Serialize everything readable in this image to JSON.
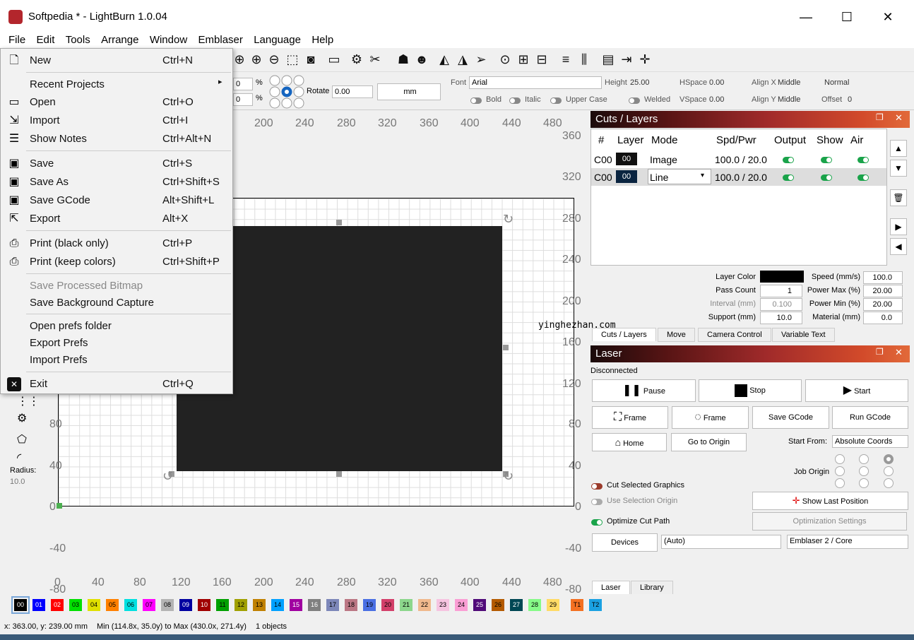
{
  "window": {
    "title": "Softpedia * - LightBurn 1.0.04",
    "minimize": "—",
    "maximize": "☐",
    "close": "✕"
  },
  "menubar": [
    "File",
    "Edit",
    "Tools",
    "Arrange",
    "Window",
    "Emblaser",
    "Language",
    "Help"
  ],
  "file_menu": [
    {
      "label": "New",
      "shortcut": "Ctrl+N",
      "icon": "new-file-icon"
    },
    {
      "label": "Recent Projects",
      "shortcut": "▸"
    },
    {
      "label": "Open",
      "shortcut": "Ctrl+O",
      "icon": "folder-icon"
    },
    {
      "label": "Import",
      "shortcut": "Ctrl+I",
      "icon": "import-icon"
    },
    {
      "label": "Show Notes",
      "shortcut": "Ctrl+Alt+N",
      "icon": "notes-icon"
    },
    {
      "label": "Save",
      "shortcut": "Ctrl+S",
      "icon": "save-icon"
    },
    {
      "label": "Save As",
      "shortcut": "Ctrl+Shift+S",
      "icon": "save-as-icon"
    },
    {
      "label": "Save GCode",
      "shortcut": "Alt+Shift+L",
      "icon": "save-gcode-icon"
    },
    {
      "label": "Export",
      "shortcut": "Alt+X",
      "icon": "export-icon"
    },
    {
      "label": "Print (black only)",
      "shortcut": "Ctrl+P",
      "icon": "printer-icon"
    },
    {
      "label": "Print (keep colors)",
      "shortcut": "Ctrl+Shift+P",
      "icon": "printer-color-icon"
    },
    {
      "label": "Save Processed Bitmap",
      "shortcut": ""
    },
    {
      "label": "Save Background Capture",
      "shortcut": ""
    },
    {
      "label": "Open prefs folder",
      "shortcut": ""
    },
    {
      "label": "Export Prefs",
      "shortcut": ""
    },
    {
      "label": "Import Prefs",
      "shortcut": ""
    },
    {
      "label": "Exit",
      "shortcut": "Ctrl+Q",
      "icon": "exit-icon"
    }
  ],
  "toolbar2": {
    "pct1": "0",
    "pct2": "0",
    "pct": "%",
    "rotate_label": "Rotate",
    "rotate": "0.00",
    "units": "mm",
    "font_label": "Font",
    "font": "Arial",
    "height_label": "Height",
    "height": "25.00",
    "hspace_label": "HSpace",
    "hspace": "0.00",
    "alignx_label": "Align X",
    "alignx": "Middle",
    "normal": "Normal",
    "bold": "Bold",
    "italic": "Italic",
    "upper": "Upper Case",
    "welded": "Welded",
    "vspace_label": "VSpace",
    "vspace": "0.00",
    "aligny_label": "Align Y",
    "aligny": "Middle",
    "offset_label": "Offset",
    "offset": "0"
  },
  "axis": {
    "top": [
      "200",
      "240",
      "280",
      "320",
      "360",
      "400",
      "440",
      "480"
    ],
    "bottom": [
      "0",
      "40",
      "80",
      "120",
      "160",
      "200",
      "240",
      "280",
      "320",
      "360",
      "400",
      "440",
      "480"
    ],
    "left": [
      "80",
      "40",
      "0",
      "-40",
      "-80"
    ],
    "right": [
      "360",
      "320",
      "280",
      "240",
      "200",
      "160",
      "120",
      "80",
      "40",
      "0",
      "-40",
      "-80"
    ]
  },
  "lefttools": {
    "radius_label": "Radius:",
    "radius": "10.0"
  },
  "cuts": {
    "title": "Cuts / Layers",
    "headers": [
      "#",
      "Layer",
      "Mode",
      "Spd/Pwr",
      "Output",
      "Show",
      "Air"
    ],
    "rows": [
      {
        "num": "C00",
        "layer": "00",
        "mode": "Image",
        "spd": "100.0 / 20.0"
      },
      {
        "num": "C00",
        "layer": "00",
        "mode": "Line",
        "spd": "100.0 / 20.0"
      }
    ],
    "props": {
      "layer_color": "Layer Color",
      "speed": "Speed (mm/s)",
      "speed_val": "100.0",
      "pass": "Pass Count",
      "pass_val": "1",
      "pmax": "Power Max (%)",
      "pmax_val": "20.00",
      "interval": "Interval (mm)",
      "interval_val": "0.100",
      "pmin": "Power Min (%)",
      "pmin_val": "20.00",
      "support": "Support (mm)",
      "support_val": "10.0",
      "material": "Material (mm)",
      "material_val": "0.0"
    },
    "tabs": [
      "Cuts / Layers",
      "Move",
      "Camera Control",
      "Variable Text"
    ]
  },
  "watermark": "yinghezhan.com",
  "laser": {
    "title": "Laser",
    "status": "Disconnected",
    "pause": "Pause",
    "stop": "Stop",
    "start": "Start",
    "frame1": "Frame",
    "frame2": "Frame",
    "save_gcode": "Save GCode",
    "run_gcode": "Run GCode",
    "home": "Home",
    "goto": "Go to Origin",
    "start_from_label": "Start From:",
    "start_from": "Absolute Coords",
    "job_origin": "Job Origin",
    "cut_selected": "Cut Selected Graphics",
    "use_sel": "Use Selection Origin",
    "show_last": "Show Last Position",
    "optimize": "Optimize Cut Path",
    "opt_settings": "Optimization Settings",
    "devices": "Devices",
    "auto": "(Auto)",
    "device": "Emblaser 2 / Core",
    "tabs": [
      "Laser",
      "Library"
    ]
  },
  "palette": [
    {
      "l": "00",
      "c": "#000000"
    },
    {
      "l": "01",
      "c": "#0000ff"
    },
    {
      "l": "02",
      "c": "#ff0000"
    },
    {
      "l": "03",
      "c": "#00e000"
    },
    {
      "l": "04",
      "c": "#e0e000"
    },
    {
      "l": "05",
      "c": "#ff8000"
    },
    {
      "l": "06",
      "c": "#00e0e0"
    },
    {
      "l": "07",
      "c": "#ff00ff"
    },
    {
      "l": "08",
      "c": "#b4b4b4"
    },
    {
      "l": "09",
      "c": "#0000a0"
    },
    {
      "l": "10",
      "c": "#a00000"
    },
    {
      "l": "11",
      "c": "#00a000"
    },
    {
      "l": "12",
      "c": "#a0a000"
    },
    {
      "l": "13",
      "c": "#c08000"
    },
    {
      "l": "14",
      "c": "#00a0ff"
    },
    {
      "l": "15",
      "c": "#a000a0"
    },
    {
      "l": "16",
      "c": "#808080"
    },
    {
      "l": "17",
      "c": "#7d87b9"
    },
    {
      "l": "18",
      "c": "#bb7784"
    },
    {
      "l": "19",
      "c": "#4a6fe3"
    },
    {
      "l": "20",
      "c": "#d33f6a"
    },
    {
      "l": "21",
      "c": "#8cd78c"
    },
    {
      "l": "22",
      "c": "#f0b98d"
    },
    {
      "l": "23",
      "c": "#f6c4e1"
    },
    {
      "l": "24",
      "c": "#fa9ed4"
    },
    {
      "l": "25",
      "c": "#500a78"
    },
    {
      "l": "26",
      "c": "#b45a00"
    },
    {
      "l": "27",
      "c": "#004754"
    },
    {
      "l": "28",
      "c": "#86fa88"
    },
    {
      "l": "29",
      "c": "#ffdb66"
    },
    {
      "l": "T1",
      "c": "#f37021"
    },
    {
      "l": "T2",
      "c": "#1ba1e2"
    }
  ],
  "status": {
    "coords": "x: 363.00, y: 239.00 mm",
    "minmax": "Min (114.8x, 35.0y) to Max (430.0x, 271.4y)",
    "objects": "1 objects"
  }
}
